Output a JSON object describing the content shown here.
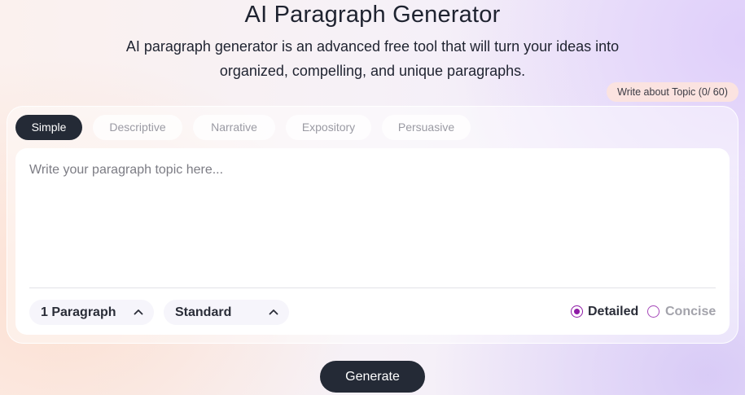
{
  "header": {
    "title": "AI Paragraph Generator",
    "subtitle": "AI paragraph generator is an advanced free tool that will turn your ideas into organized, compelling, and unique paragraphs."
  },
  "topic_counter": "Write about Topic (0/ 60)",
  "tabs": [
    {
      "label": "Simple",
      "active": true
    },
    {
      "label": "Descriptive",
      "active": false
    },
    {
      "label": "Narrative",
      "active": false
    },
    {
      "label": "Expository",
      "active": false
    },
    {
      "label": "Persuasive",
      "active": false
    }
  ],
  "editor": {
    "value": "",
    "placeholder": "Write your paragraph topic here..."
  },
  "controls": {
    "paragraph_count": "1 Paragraph",
    "tone": "Standard",
    "length_options": [
      {
        "label": "Detailed",
        "selected": true
      },
      {
        "label": "Concise",
        "selected": false
      }
    ]
  },
  "generate_label": "Generate",
  "colors": {
    "dark": "#242a36",
    "accent_purple": "#8e1aa6",
    "badge_bg": "#fbe3e0"
  },
  "icons": {
    "select_chevron": "chevron-up-icon"
  }
}
